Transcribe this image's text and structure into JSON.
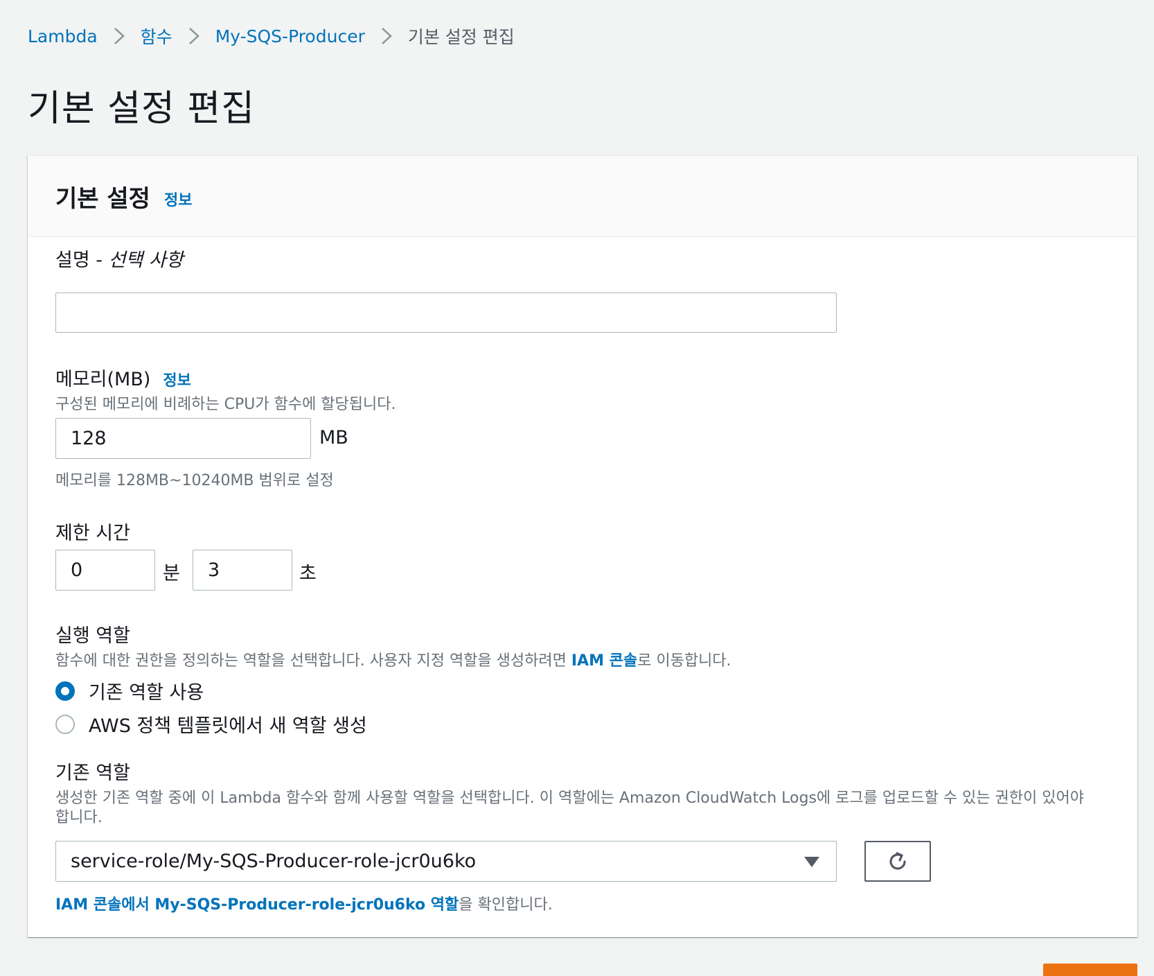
{
  "breadcrumb": {
    "items": [
      "Lambda",
      "함수",
      "My-SQS-Producer"
    ],
    "current": "기본 설정 편집"
  },
  "page_title": "기본 설정 편집",
  "section": {
    "title": "기본 설정",
    "info_label": "정보"
  },
  "description_field": {
    "label_prefix": "설명 - ",
    "label_optional": "선택 사항",
    "value": ""
  },
  "memory_field": {
    "label": "메모리(MB)",
    "info_label": "정보",
    "description": "구성된 메모리에 비례하는 CPU가 함수에 할당됩니다.",
    "value": "128",
    "unit": "MB",
    "hint": "메모리를 128MB~10240MB 범위로 설정"
  },
  "timeout_field": {
    "label": "제한 시간",
    "minutes_value": "0",
    "minutes_unit": "분",
    "seconds_value": "3",
    "seconds_unit": "초"
  },
  "execution_role": {
    "label": "실행 역할",
    "description_before": "함수에 대한 권한을 정의하는 역할을 선택합니다. 사용자 지정 역할을 생성하려면 ",
    "description_link": "IAM 콘솔",
    "description_after": "로 이동합니다.",
    "options": [
      {
        "label": "기존 역할 사용",
        "checked": true
      },
      {
        "label": "AWS 정책 템플릿에서 새 역할 생성",
        "checked": false
      }
    ]
  },
  "existing_role": {
    "label": "기존 역할",
    "description_line1": "생성한 기존 역할 중에 이 Lambda 함수와 함께 사용할 역할을 선택합니다. 이 역할에는 Amazon CloudWatch Logs에 로그를 업로드할 수 있는 권한이 있어야",
    "description_line2": "합니다.",
    "selected_value": "service-role/My-SQS-Producer-role-jcr0u6ko",
    "view_link": "IAM 콘솔에서 My-SQS-Producer-role-jcr0u6ko 역할",
    "view_suffix": "을 확인합니다."
  },
  "colors": {
    "link": "#0073bb",
    "primary_button": "#ec7211",
    "background": "#f2f3f3"
  }
}
